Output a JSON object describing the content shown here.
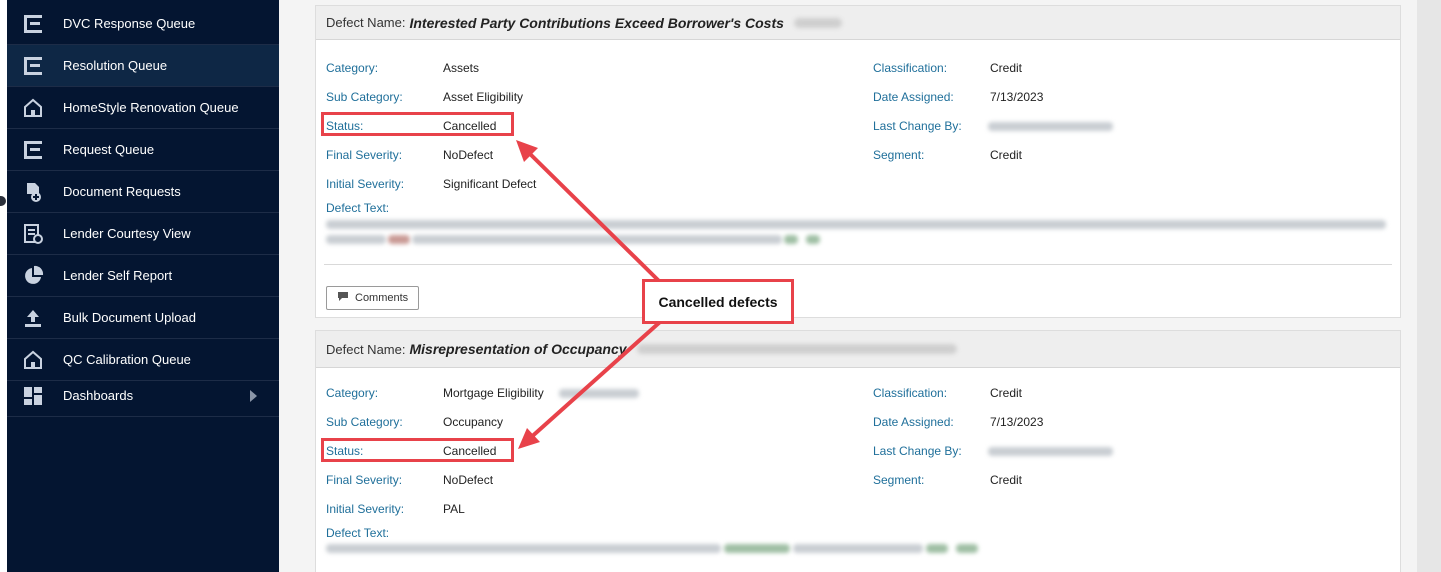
{
  "sidebar": {
    "items": [
      {
        "label": "DVC Response Queue",
        "icon": "list-icon"
      },
      {
        "label": "Resolution Queue",
        "icon": "list-icon",
        "active": true
      },
      {
        "label": "HomeStyle Renovation Queue",
        "icon": "home-icon"
      },
      {
        "label": "Request Queue",
        "icon": "list-icon"
      },
      {
        "label": "Document Requests",
        "icon": "document-add-icon"
      },
      {
        "label": "Lender Courtesy View",
        "icon": "report-view-icon"
      },
      {
        "label": "Lender Self Report",
        "icon": "pie-chart-icon"
      },
      {
        "label": "Bulk Document Upload",
        "icon": "upload-icon"
      },
      {
        "label": "QC Calibration Queue",
        "icon": "home-icon"
      },
      {
        "label": "Dashboards",
        "icon": "dashboard-icon"
      }
    ]
  },
  "defects": [
    {
      "name_label": "Defect Name:",
      "name": "Interested Party Contributions Exceed Borrower's Costs",
      "fields_left": [
        {
          "label": "Category:",
          "value": "Assets"
        },
        {
          "label": "Sub Category:",
          "value": "Asset Eligibility"
        },
        {
          "label": "Status:",
          "value": "Cancelled"
        },
        {
          "label": "Final Severity:",
          "value": "NoDefect"
        },
        {
          "label": "Initial Severity:",
          "value": "Significant Defect"
        }
      ],
      "fields_right": [
        {
          "label": "Classification:",
          "value": "Credit"
        },
        {
          "label": "Date Assigned:",
          "value": "7/13/2023"
        },
        {
          "label": "Last Change By:",
          "value": ""
        },
        {
          "label": "Segment:",
          "value": "Credit"
        }
      ],
      "defect_text_label": "Defect Text:",
      "comments_label": "Comments"
    },
    {
      "name_label": "Defect Name:",
      "name": "Misrepresentation of Occupancy",
      "fields_left": [
        {
          "label": "Category:",
          "value": "Mortgage Eligibility"
        },
        {
          "label": "Sub Category:",
          "value": "Occupancy"
        },
        {
          "label": "Status:",
          "value": "Cancelled"
        },
        {
          "label": "Final Severity:",
          "value": "NoDefect"
        },
        {
          "label": "Initial Severity:",
          "value": "PAL"
        }
      ],
      "fields_right": [
        {
          "label": "Classification:",
          "value": "Credit"
        },
        {
          "label": "Date Assigned:",
          "value": "7/13/2023"
        },
        {
          "label": "Last Change By:",
          "value": ""
        },
        {
          "label": "Segment:",
          "value": "Credit"
        }
      ],
      "defect_text_label": "Defect Text:"
    }
  ],
  "annotation": {
    "callout_text": "Cancelled defects",
    "color": "#e8424a"
  },
  "colors": {
    "sidebar_bg": "#041531",
    "label_blue": "#1f6f9a",
    "annotation_red": "#e8424a"
  }
}
